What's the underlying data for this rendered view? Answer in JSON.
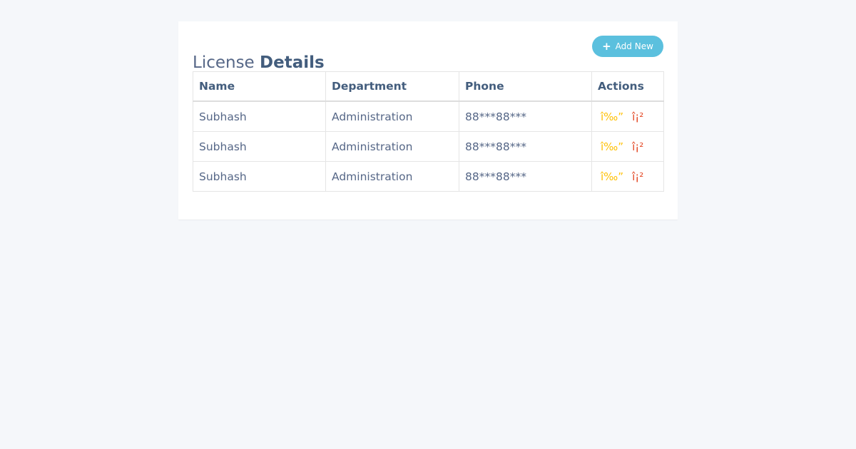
{
  "page": {
    "title_light": "License",
    "title_bold": "Details"
  },
  "toolbar": {
    "add_icon": "+",
    "add_label": "Add New"
  },
  "table": {
    "headers": [
      "Name",
      "Department",
      "Phone",
      "Actions"
    ],
    "rows": [
      {
        "name": "Subhash",
        "department": "Administration",
        "phone": "88***88***",
        "edit_glyph": "î‰”",
        "delete_glyph": "î¡²"
      },
      {
        "name": "Subhash",
        "department": "Administration",
        "phone": "88***88***",
        "edit_glyph": "î‰”",
        "delete_glyph": "î¡²"
      },
      {
        "name": "Subhash",
        "department": "Administration",
        "phone": "88***88***",
        "edit_glyph": "î‰”",
        "delete_glyph": "î¡²"
      }
    ]
  },
  "colors": {
    "accent": "#5bc0de",
    "edit": "#ffc107",
    "delete": "#e34724",
    "heading": "#435d7d"
  },
  "icons": {
    "add": "plus-icon",
    "edit": "edit-icon",
    "delete": "delete-icon"
  }
}
